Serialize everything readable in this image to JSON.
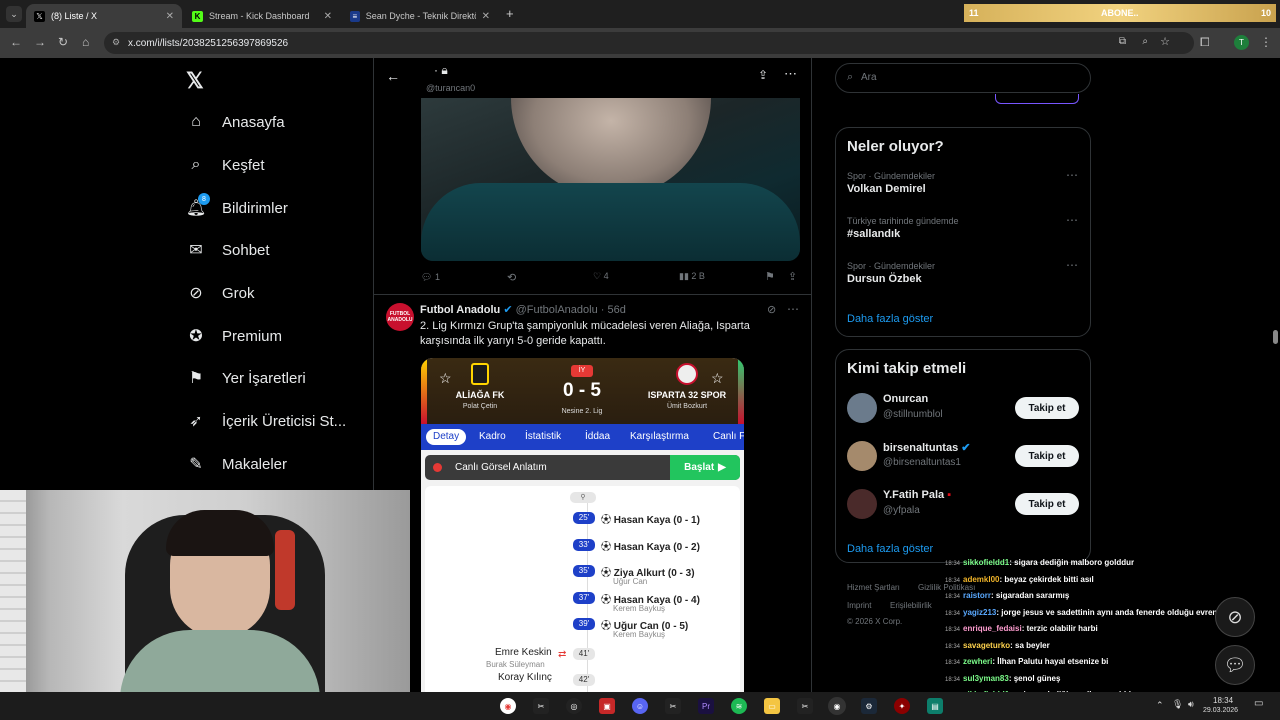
{
  "tabs": [
    {
      "label": "(8) Liste / X",
      "favicon": "x-icon"
    },
    {
      "label": "Stream - Kick Dashboard",
      "favicon": "kick-icon"
    },
    {
      "label": "Sean Dyche - Teknik Direktör p",
      "favicon": "page-icon"
    }
  ],
  "subscribe_bar": {
    "left": "11",
    "label": "ABONE..",
    "right": "10"
  },
  "url": "x.com/i/lists/2038251256397869526",
  "profile_initial": "T",
  "nav": {
    "home": "Anasayfa",
    "explore": "Keşfet",
    "notifications": "Bildirimler",
    "notifications_badge": "8",
    "chat": "Sohbet",
    "grok": "Grok",
    "premium": "Premium",
    "bookmarks": "Yer İşaretleri",
    "creator": "İçerik Üreticisi St...",
    "articles": "Makaleler"
  },
  "list_header": {
    "handle": "@turancan0"
  },
  "tweet1_actions": {
    "replies": "1",
    "likes": "4",
    "views": "2 B"
  },
  "tweet2": {
    "avatar_text": "FUTBOL ANADOLU",
    "name": "Futbol Anadolu",
    "handle": "@FutbolAnadolu",
    "time": "56d",
    "text": "2. Lig Kırmızı Grup'ta şampiyonluk mücadelesi veren Aliağa, Isparta karşısında ilk yarıyı 5-0 geride kapattı."
  },
  "match": {
    "home": "ALİAĞA FK",
    "home_coach": "Polat Çetin",
    "away": "ISPARTA 32 SPOR",
    "away_coach": "Ümit Bozkurt",
    "period": "İY",
    "score": "0 - 5",
    "league": "Nesine 2. Lig",
    "tabs": [
      "Detay",
      "Kadro",
      "İstatistik",
      "İddaa",
      "Karşılaştırma",
      "Canlı F"
    ],
    "live_label": "Canlı Görsel Anlatım",
    "start_label": "Başlat",
    "events": [
      {
        "min": "25'",
        "scorer": "Hasan Kaya (0 - 1)",
        "assist": ""
      },
      {
        "min": "33'",
        "scorer": "Hasan Kaya (0 - 2)",
        "assist": ""
      },
      {
        "min": "35'",
        "scorer": "Ziya Alkurt (0 - 3)",
        "assist": "Uğur Can"
      },
      {
        "min": "37'",
        "scorer": "Hasan Kaya (0 - 4)",
        "assist": "Kerem Baykuş"
      },
      {
        "min": "39'",
        "scorer": "Uğur Can (0 - 5)",
        "assist": "Kerem Baykuş"
      }
    ],
    "sub": {
      "min": "41'",
      "in": "Emre Keskin",
      "out": "Burak Süleyman"
    },
    "sub2": {
      "min": "42'",
      "name": "Koray Kılınç"
    }
  },
  "search_placeholder": "Ara",
  "trends": {
    "title": "Neler oluyor?",
    "items": [
      {
        "meta": "Spor · Gündemdekiler",
        "name": "Volkan Demirel"
      },
      {
        "meta": "Türkiye tarihinde gündemde",
        "name": "#sallandık"
      },
      {
        "meta": "Spor · Gündemdekiler",
        "name": "Dursun Özbek"
      }
    ],
    "more": "Daha fazla göster"
  },
  "who_to_follow": {
    "title": "Kimi takip etmeli",
    "items": [
      {
        "name": "Onurcan",
        "handle": "@stillnumblol"
      },
      {
        "name": "birsenaltuntas",
        "handle": "@birsenaltuntas1"
      },
      {
        "name": "Y.Fatih Pala",
        "handle": "@yfpala"
      }
    ],
    "button": "Takip et",
    "more": "Daha fazla göster"
  },
  "footer": {
    "terms": "Hizmet Şartları",
    "privacy": "Gizlilik Politikası",
    "imprint": "Imprint",
    "accessibility": "Erişilebilirlik",
    "copyright": "© 2026 X Corp."
  },
  "chat": [
    {
      "ts": "18:34",
      "user": "sikkofieldd1",
      "color": "#7CFC8A",
      "msg": ": sigara dediğin malboro golddur"
    },
    {
      "ts": "18:34",
      "user": "ademkl00",
      "color": "#F0B429",
      "msg": ": beyaz çekirdek bitti asıl"
    },
    {
      "ts": "18:34",
      "user": "raistorr",
      "color": "#5AA9FF",
      "msg": ": sigaradan sararmış"
    },
    {
      "ts": "18:34",
      "user": "yagiz213",
      "color": "#5AA9FF",
      "msg": ": jorge jesus ve sadettinin aynı anda fenerde olduğu evren"
    },
    {
      "ts": "18:34",
      "user": "enrique_fedaisi",
      "color": "#FF9DD0",
      "msg": ": terzic olabilir harbi"
    },
    {
      "ts": "18:34",
      "user": "savageturko",
      "color": "#FFD34E",
      "msg": ": sa beyler"
    },
    {
      "ts": "18:34",
      "user": "zewheri",
      "color": "#7CFC8A",
      "msg": ": İlhan Palutu hayal etsenize bi"
    },
    {
      "ts": "18:34",
      "user": "sul3yman83",
      "color": "#7CFC8A",
      "msg": ": şenol güneş"
    },
    {
      "ts": "18:34",
      "user": "sikkofieldd1",
      "color": "#7CFC8A",
      "msg": ": : sigara dediğin malboro golddur"
    },
    {
      "ts": "18:34",
      "user": "Dejavuu07",
      "color": "#B18CFF",
      "msg": ": solskajerr yakışır totenhama"
    }
  ],
  "clock": {
    "time": "18:34",
    "date": "29.03.2026"
  }
}
